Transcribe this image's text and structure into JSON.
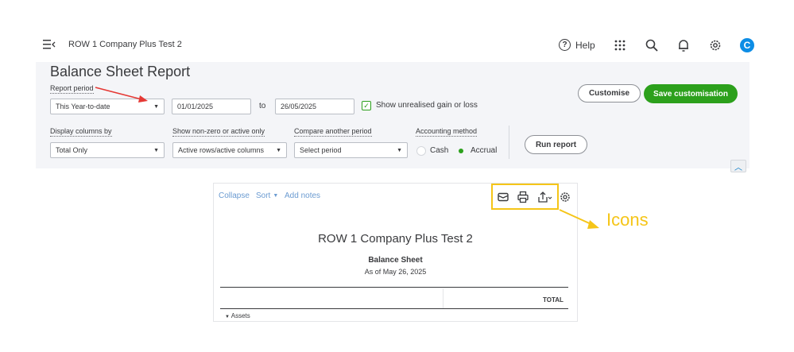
{
  "topbar": {
    "company_name": "ROW 1 Company Plus Test 2",
    "help_label": "Help",
    "help_icon_glyph": "?",
    "avatar_letter": "C",
    "icons": [
      "menu-icon",
      "apps-grid-icon",
      "search-icon",
      "bell-icon",
      "gear-icon"
    ]
  },
  "settings": {
    "page_title": "Balance Sheet Report",
    "report_period_label": "Report period",
    "report_period_value": "This Year-to-date",
    "date_from": "01/01/2025",
    "to_label": "to",
    "date_to": "26/05/2025",
    "unrealised_label": "Show unrealised gain or loss",
    "unrealised_checked": true,
    "customise_label": "Customise",
    "save_label": "Save customisation",
    "display_columns_label": "Display columns by",
    "display_columns_value": "Total Only",
    "nonzero_label": "Show non-zero or active only",
    "nonzero_value": "Active rows/active columns",
    "compare_label": "Compare another period",
    "compare_placeholder": "Select period",
    "accounting_label": "Accounting method",
    "cash_label": "Cash",
    "accrual_label": "Accrual",
    "accounting_selected": "Accrual",
    "run_report_label": "Run report"
  },
  "report": {
    "collapse_label": "Collapse",
    "sort_label": "Sort",
    "add_notes_label": "Add notes",
    "toolbar_icons": [
      "email-icon",
      "print-icon",
      "export-icon",
      "settings-gear-icon"
    ],
    "company_name": "ROW 1 Company Plus Test 2",
    "title": "Balance Sheet",
    "as_of": "As of May 26, 2025",
    "total_header": "TOTAL",
    "assets_label": "Assets"
  },
  "annotation": {
    "label": "Icons",
    "color": "#f5c518",
    "red_arrow_color": "#e53935"
  },
  "colors": {
    "accent_green": "#2ca01c",
    "link_blue": "#6b9bd1",
    "panel_bg": "#f4f5f8"
  }
}
